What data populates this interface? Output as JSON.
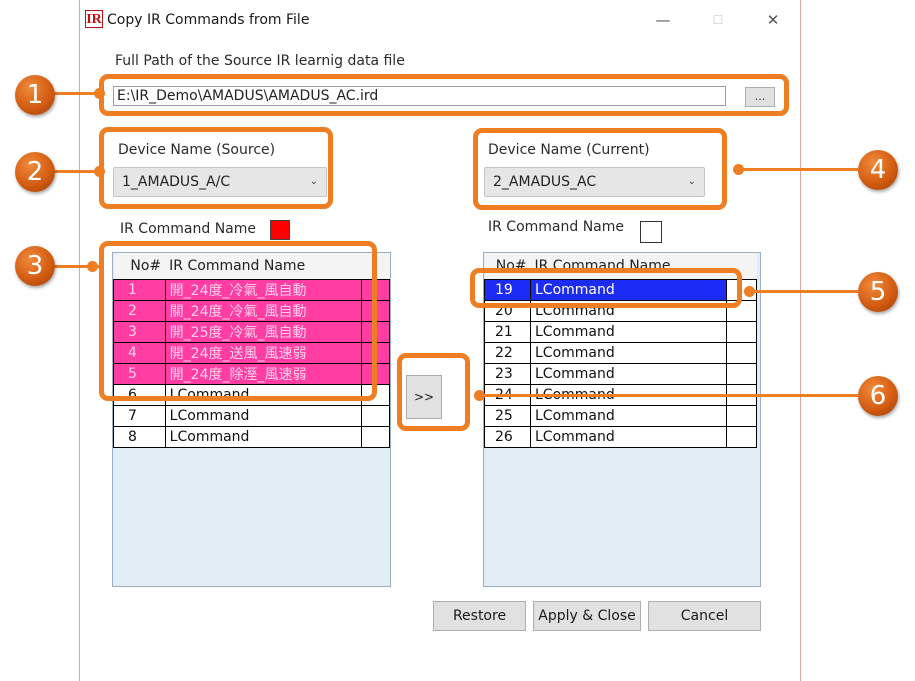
{
  "window": {
    "title": "Copy IR Commands from File",
    "app_icon": "IR",
    "minimize": "—",
    "maximize": "☐",
    "close": "✕"
  },
  "source_path": {
    "label": "Full Path of the Source IR learnig data file",
    "value": "E:\\IR_Demo\\AMADUS\\AMADUS_AC.ird",
    "browse_label": "..."
  },
  "source_device": {
    "label": "Device Name (Source)",
    "value": "1_AMADUS_A/C"
  },
  "current_device": {
    "label": "Device Name (Current)",
    "value": "2_AMADUS_AC"
  },
  "source_list": {
    "label": "IR Command Name",
    "swatch_color": "#ff0000",
    "columns": [
      "No#",
      "IR Command Name"
    ],
    "rows": [
      {
        "no": "1",
        "name": "開_24度_冷氣_風自動"
      },
      {
        "no": "2",
        "name": "關_24度_冷氣_風自動"
      },
      {
        "no": "3",
        "name": "開_25度_冷氣_風自動"
      },
      {
        "no": "4",
        "name": "開_24度_送風_風速弱"
      },
      {
        "no": "5",
        "name": "開_24度_除溼_風速弱"
      },
      {
        "no": "6",
        "name": "LCommand"
      },
      {
        "no": "7",
        "name": "LCommand"
      },
      {
        "no": "8",
        "name": "LCommand"
      }
    ]
  },
  "current_list": {
    "label": "IR Command Name",
    "columns": [
      "No#",
      "IR Command Name"
    ],
    "rows": [
      {
        "no": "19",
        "name": "LCommand"
      },
      {
        "no": "20",
        "name": "LCommand"
      },
      {
        "no": "21",
        "name": "LCommand"
      },
      {
        "no": "22",
        "name": "LCommand"
      },
      {
        "no": "23",
        "name": "LCommand"
      },
      {
        "no": "24",
        "name": "LCommand"
      },
      {
        "no": "25",
        "name": "LCommand"
      },
      {
        "no": "26",
        "name": "LCommand"
      }
    ]
  },
  "copy_button": ">>",
  "buttons": {
    "restore": "Restore",
    "apply": "Apply & Close",
    "cancel": "Cancel"
  },
  "callouts": [
    "1",
    "2",
    "3",
    "4",
    "5",
    "6"
  ],
  "colors": {
    "accent": "#ef7d22",
    "selected_row": "#1d2cf5",
    "pink_row": "#ff3da3"
  }
}
